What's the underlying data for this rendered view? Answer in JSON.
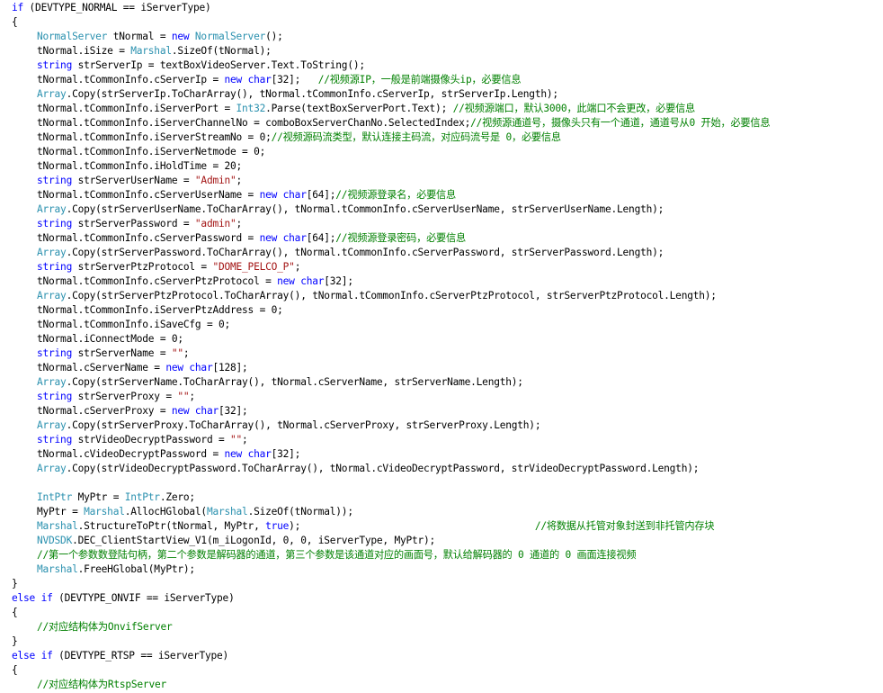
{
  "editor": {
    "lines": [
      {
        "indent": 0,
        "segs": [
          [
            "kw",
            "if"
          ],
          [
            "p",
            " (DEVTYPE_NORMAL == iServerType)"
          ]
        ]
      },
      {
        "indent": 0,
        "segs": [
          [
            "p",
            "{"
          ]
        ]
      },
      {
        "indent": 1,
        "segs": [
          [
            "ty",
            "NormalServer"
          ],
          [
            "p",
            " tNormal = "
          ],
          [
            "kw",
            "new"
          ],
          [
            "p",
            " "
          ],
          [
            "ty",
            "NormalServer"
          ],
          [
            "p",
            "();"
          ]
        ]
      },
      {
        "indent": 1,
        "segs": [
          [
            "p",
            "tNormal.iSize = "
          ],
          [
            "ty",
            "Marshal"
          ],
          [
            "p",
            ".SizeOf(tNormal);"
          ]
        ]
      },
      {
        "indent": 1,
        "segs": [
          [
            "kw",
            "string"
          ],
          [
            "p",
            " strServerIp = textBoxVideoServer.Text.ToString();"
          ]
        ]
      },
      {
        "indent": 1,
        "segs": [
          [
            "p",
            "tNormal.tCommonInfo.cServerIp = "
          ],
          [
            "kw",
            "new"
          ],
          [
            "p",
            " "
          ],
          [
            "kw",
            "char"
          ],
          [
            "p",
            "[32];   "
          ],
          [
            "cm",
            "//视频源IP，一般是前端摄像头ip，必要信息"
          ]
        ]
      },
      {
        "indent": 1,
        "segs": [
          [
            "ty",
            "Array"
          ],
          [
            "p",
            ".Copy(strServerIp.ToCharArray(), tNormal.tCommonInfo.cServerIp, strServerIp.Length);"
          ]
        ]
      },
      {
        "indent": 1,
        "segs": [
          [
            "p",
            "tNormal.tCommonInfo.iServerPort = "
          ],
          [
            "ty",
            "Int32"
          ],
          [
            "p",
            ".Parse(textBoxServerPort.Text); "
          ],
          [
            "cm",
            "//视频源端口，默认3000，此端口不会更改，必要信息"
          ]
        ]
      },
      {
        "indent": 1,
        "segs": [
          [
            "p",
            "tNormal.tCommonInfo.iServerChannelNo = comboBoxServerChanNo.SelectedIndex;"
          ],
          [
            "cm",
            "//视频源通道号，摄像头只有一个通道，通道号从0 开始，必要信息"
          ]
        ]
      },
      {
        "indent": 1,
        "segs": [
          [
            "p",
            "tNormal.tCommonInfo.iServerStreamNo = 0;"
          ],
          [
            "cm",
            "//视频源码流类型，默认连接主码流，对应码流号是 0，必要信息"
          ]
        ]
      },
      {
        "indent": 1,
        "segs": [
          [
            "p",
            "tNormal.tCommonInfo.iServerNetmode = 0;"
          ]
        ]
      },
      {
        "indent": 1,
        "segs": [
          [
            "p",
            "tNormal.tCommonInfo.iHoldTime = 20;"
          ]
        ]
      },
      {
        "indent": 1,
        "segs": [
          [
            "kw",
            "string"
          ],
          [
            "p",
            " strServerUserName = "
          ],
          [
            "st",
            "\"Admin\""
          ],
          [
            "p",
            ";"
          ]
        ]
      },
      {
        "indent": 1,
        "segs": [
          [
            "p",
            "tNormal.tCommonInfo.cServerUserName = "
          ],
          [
            "kw",
            "new"
          ],
          [
            "p",
            " "
          ],
          [
            "kw",
            "char"
          ],
          [
            "p",
            "[64];"
          ],
          [
            "cm",
            "//视频源登录名，必要信息"
          ]
        ]
      },
      {
        "indent": 1,
        "segs": [
          [
            "ty",
            "Array"
          ],
          [
            "p",
            ".Copy(strServerUserName.ToCharArray(), tNormal.tCommonInfo.cServerUserName, strServerUserName.Length);"
          ]
        ]
      },
      {
        "indent": 1,
        "segs": [
          [
            "kw",
            "string"
          ],
          [
            "p",
            " strServerPassword = "
          ],
          [
            "st",
            "\"admin\""
          ],
          [
            "p",
            ";"
          ]
        ]
      },
      {
        "indent": 1,
        "segs": [
          [
            "p",
            "tNormal.tCommonInfo.cServerPassword = "
          ],
          [
            "kw",
            "new"
          ],
          [
            "p",
            " "
          ],
          [
            "kw",
            "char"
          ],
          [
            "p",
            "[64];"
          ],
          [
            "cm",
            "//视频源登录密码，必要信息"
          ]
        ]
      },
      {
        "indent": 1,
        "segs": [
          [
            "ty",
            "Array"
          ],
          [
            "p",
            ".Copy(strServerPassword.ToCharArray(), tNormal.tCommonInfo.cServerPassword, strServerPassword.Length);"
          ]
        ]
      },
      {
        "indent": 1,
        "segs": [
          [
            "kw",
            "string"
          ],
          [
            "p",
            " strServerPtzProtocol = "
          ],
          [
            "st",
            "\"DOME_PELCO_P\""
          ],
          [
            "p",
            ";"
          ]
        ]
      },
      {
        "indent": 1,
        "segs": [
          [
            "p",
            "tNormal.tCommonInfo.cServerPtzProtocol = "
          ],
          [
            "kw",
            "new"
          ],
          [
            "p",
            " "
          ],
          [
            "kw",
            "char"
          ],
          [
            "p",
            "[32];"
          ]
        ]
      },
      {
        "indent": 1,
        "segs": [
          [
            "ty",
            "Array"
          ],
          [
            "p",
            ".Copy(strServerPtzProtocol.ToCharArray(), tNormal.tCommonInfo.cServerPtzProtocol, strServerPtzProtocol.Length);"
          ]
        ]
      },
      {
        "indent": 1,
        "segs": [
          [
            "p",
            "tNormal.tCommonInfo.iServerPtzAddress = 0;"
          ]
        ]
      },
      {
        "indent": 1,
        "segs": [
          [
            "p",
            "tNormal.tCommonInfo.iSaveCfg = 0;"
          ]
        ]
      },
      {
        "indent": 1,
        "segs": [
          [
            "p",
            "tNormal.iConnectMode = 0;"
          ]
        ]
      },
      {
        "indent": 1,
        "segs": [
          [
            "kw",
            "string"
          ],
          [
            "p",
            " strServerName = "
          ],
          [
            "st",
            "\"\""
          ],
          [
            "p",
            ";"
          ]
        ]
      },
      {
        "indent": 1,
        "segs": [
          [
            "p",
            "tNormal.cServerName = "
          ],
          [
            "kw",
            "new"
          ],
          [
            "p",
            " "
          ],
          [
            "kw",
            "char"
          ],
          [
            "p",
            "[128];"
          ]
        ]
      },
      {
        "indent": 1,
        "segs": [
          [
            "ty",
            "Array"
          ],
          [
            "p",
            ".Copy(strServerName.ToCharArray(), tNormal.cServerName, strServerName.Length);"
          ]
        ]
      },
      {
        "indent": 1,
        "segs": [
          [
            "kw",
            "string"
          ],
          [
            "p",
            " strServerProxy = "
          ],
          [
            "st",
            "\"\""
          ],
          [
            "p",
            ";"
          ]
        ]
      },
      {
        "indent": 1,
        "segs": [
          [
            "p",
            "tNormal.cServerProxy = "
          ],
          [
            "kw",
            "new"
          ],
          [
            "p",
            " "
          ],
          [
            "kw",
            "char"
          ],
          [
            "p",
            "[32];"
          ]
        ]
      },
      {
        "indent": 1,
        "segs": [
          [
            "ty",
            "Array"
          ],
          [
            "p",
            ".Copy(strServerProxy.ToCharArray(), tNormal.cServerProxy, strServerProxy.Length);"
          ]
        ]
      },
      {
        "indent": 1,
        "segs": [
          [
            "kw",
            "string"
          ],
          [
            "p",
            " strVideoDecryptPassword = "
          ],
          [
            "st",
            "\"\""
          ],
          [
            "p",
            ";"
          ]
        ]
      },
      {
        "indent": 1,
        "segs": [
          [
            "p",
            "tNormal.cVideoDecryptPassword = "
          ],
          [
            "kw",
            "new"
          ],
          [
            "p",
            " "
          ],
          [
            "kw",
            "char"
          ],
          [
            "p",
            "[32];"
          ]
        ]
      },
      {
        "indent": 1,
        "segs": [
          [
            "ty",
            "Array"
          ],
          [
            "p",
            ".Copy(strVideoDecryptPassword.ToCharArray(), tNormal.cVideoDecryptPassword, strVideoDecryptPassword.Length);"
          ]
        ]
      },
      {
        "indent": 1,
        "segs": []
      },
      {
        "indent": 1,
        "segs": [
          [
            "ty",
            "IntPtr"
          ],
          [
            "p",
            " MyPtr = "
          ],
          [
            "ty",
            "IntPtr"
          ],
          [
            "p",
            ".Zero;"
          ]
        ]
      },
      {
        "indent": 1,
        "segs": [
          [
            "p",
            "MyPtr = "
          ],
          [
            "ty",
            "Marshal"
          ],
          [
            "p",
            ".AllocHGlobal("
          ],
          [
            "ty",
            "Marshal"
          ],
          [
            "p",
            ".SizeOf(tNormal));"
          ]
        ]
      },
      {
        "indent": 1,
        "segs": [
          [
            "ty",
            "Marshal"
          ],
          [
            "p",
            ".StructureToPtr(tNormal, MyPtr, "
          ],
          [
            "kw",
            "true"
          ],
          [
            "p",
            ");                                        "
          ],
          [
            "cm",
            "//将数据从托管对象封送到非托管内存块"
          ]
        ]
      },
      {
        "indent": 1,
        "segs": [
          [
            "ty",
            "NVDSDK"
          ],
          [
            "p",
            ".DEC_ClientStartView_V1(m_iLogonId, 0, 0, iServerType, MyPtr);"
          ]
        ]
      },
      {
        "indent": 1,
        "segs": [
          [
            "cm",
            "//第一个参数数登陆句柄，第二个参数是解码器的通道，第三个参数是该通道对应的画面号，默认给解码器的 0 通道的 0 画面连接视频"
          ]
        ]
      },
      {
        "indent": 1,
        "segs": [
          [
            "ty",
            "Marshal"
          ],
          [
            "p",
            ".FreeHGlobal(MyPtr);"
          ]
        ]
      },
      {
        "indent": 0,
        "segs": [
          [
            "p",
            "}"
          ]
        ]
      },
      {
        "indent": 0,
        "segs": [
          [
            "kw",
            "else if"
          ],
          [
            "p",
            " (DEVTYPE_ONVIF == iServerType)"
          ]
        ]
      },
      {
        "indent": 0,
        "segs": [
          [
            "p",
            "{"
          ]
        ]
      },
      {
        "indent": 1,
        "segs": [
          [
            "cm",
            "//对应结构体为OnvifServer"
          ]
        ]
      },
      {
        "indent": 0,
        "segs": [
          [
            "p",
            "}"
          ]
        ]
      },
      {
        "indent": 0,
        "segs": [
          [
            "kw",
            "else if"
          ],
          [
            "p",
            " (DEVTYPE_RTSP == iServerType)"
          ]
        ]
      },
      {
        "indent": 0,
        "segs": [
          [
            "p",
            "{"
          ]
        ]
      },
      {
        "indent": 1,
        "segs": [
          [
            "cm",
            "//对应结构体为RtspServer"
          ]
        ]
      }
    ]
  }
}
